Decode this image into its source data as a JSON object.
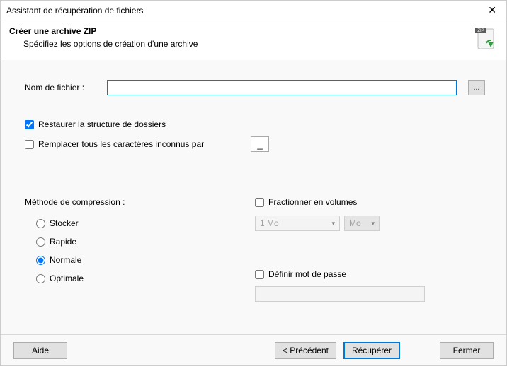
{
  "window": {
    "title": "Assistant de récupération de fichiers",
    "close_glyph": "✕"
  },
  "header": {
    "heading": "Créer une archive ZIP",
    "subtitle": "Spécifiez les options de création d'une archive",
    "icon_badge": "ZIP"
  },
  "file": {
    "label": "Nom de fichier :",
    "value": "",
    "browse_label": "..."
  },
  "options": {
    "restore_structure": {
      "checked": true,
      "label": "Restaurer la structure de dossiers"
    },
    "replace_unknown": {
      "checked": false,
      "label": "Remplacer tous les caractères inconnus par",
      "value": "_"
    }
  },
  "compression": {
    "label": "Méthode de compression :",
    "methods": [
      "Stocker",
      "Rapide",
      "Normale",
      "Optimale"
    ],
    "selected": "Normale"
  },
  "volumes": {
    "split": {
      "checked": false,
      "label": "Fractionner en volumes"
    },
    "size_value": "1 Mo",
    "unit_value": "Mo"
  },
  "password": {
    "set": {
      "checked": false,
      "label": "Définir mot de passe"
    },
    "value": ""
  },
  "footer": {
    "help": "Aide",
    "back": "< Précédent",
    "recover": "Récupérer",
    "close": "Fermer"
  }
}
